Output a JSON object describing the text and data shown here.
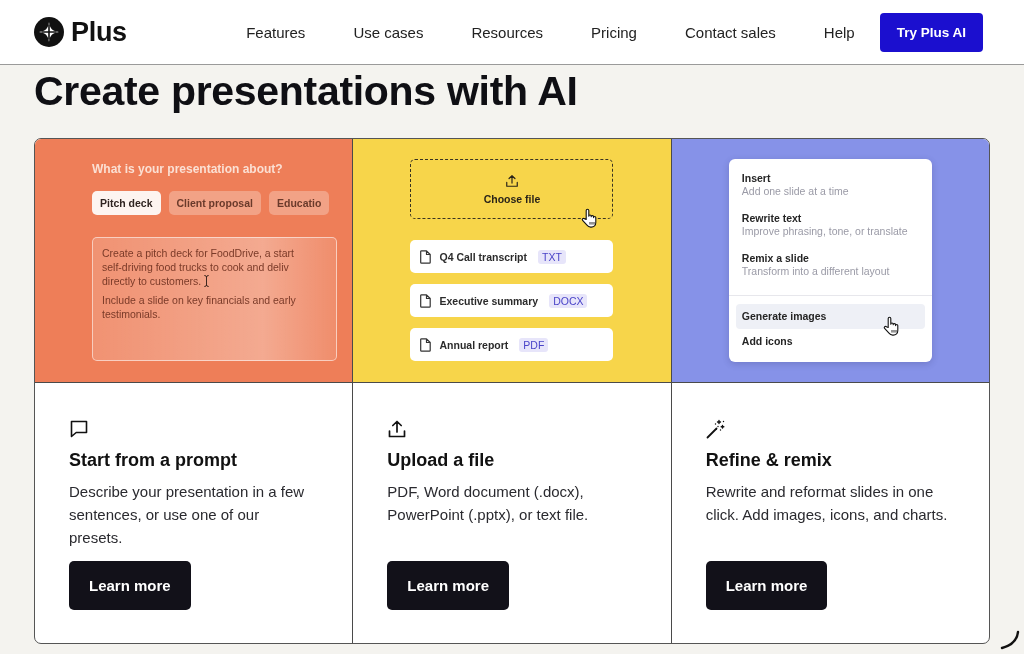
{
  "nav": {
    "logo": "Plus",
    "links": [
      "Features",
      "Use cases",
      "Resources",
      "Pricing",
      "Contact sales",
      "Help"
    ],
    "cta": "Try Plus AI"
  },
  "heading": "Create presentations with AI",
  "features": [
    {
      "illustration": {
        "kind": "prompt",
        "color": "#ee7e58",
        "question": "What is your presentation about?",
        "chips": [
          {
            "label": "Pitch deck",
            "selected": true
          },
          {
            "label": "Client proposal",
            "selected": false
          },
          {
            "label": "Educatio",
            "selected": false
          }
        ],
        "paragraphs": [
          {
            "lines": [
              "Create a pitch deck for FoodDrive, a start",
              "self-driving food trucks to cook and deliv",
              "directly to customers."
            ],
            "cursor": true
          },
          {
            "lines": [
              "Include a slide on key financials and early",
              "testimonials."
            ],
            "cursor": false
          }
        ]
      },
      "title": "Start from a prompt",
      "description": "Describe your presentation in a few sentences, or use one of our presets.",
      "button": "Learn more"
    },
    {
      "illustration": {
        "kind": "upload",
        "color": "#f7d54a",
        "dropzone": "Choose file",
        "files": [
          {
            "name": "Q4 Call transcript",
            "type": "TXT"
          },
          {
            "name": "Executive summary",
            "type": "DOCX"
          },
          {
            "name": "Annual report",
            "type": "PDF"
          }
        ]
      },
      "title": "Upload a file",
      "description": "PDF, Word document (.docx), PowerPoint (.pptx), or text file.",
      "button": "Learn more"
    },
    {
      "illustration": {
        "kind": "menu",
        "color": "#8692e8",
        "sections": [
          {
            "items": [
              {
                "title": "Insert",
                "description": "Add one slide at a time",
                "selected": false
              },
              {
                "title": "Rewrite text",
                "description": "Improve phrasing, tone, or translate",
                "selected": false
              },
              {
                "title": "Remix a slide",
                "description": "Transform into a different layout",
                "selected": false
              }
            ]
          },
          {
            "items": [
              {
                "title": "Generate images",
                "selected": true
              },
              {
                "title": "Add icons",
                "selected": false
              }
            ]
          }
        ]
      },
      "title": "Refine & remix",
      "description": "Rewrite and reformat slides in one click. Add images, icons, and charts.",
      "button": "Learn more"
    }
  ]
}
